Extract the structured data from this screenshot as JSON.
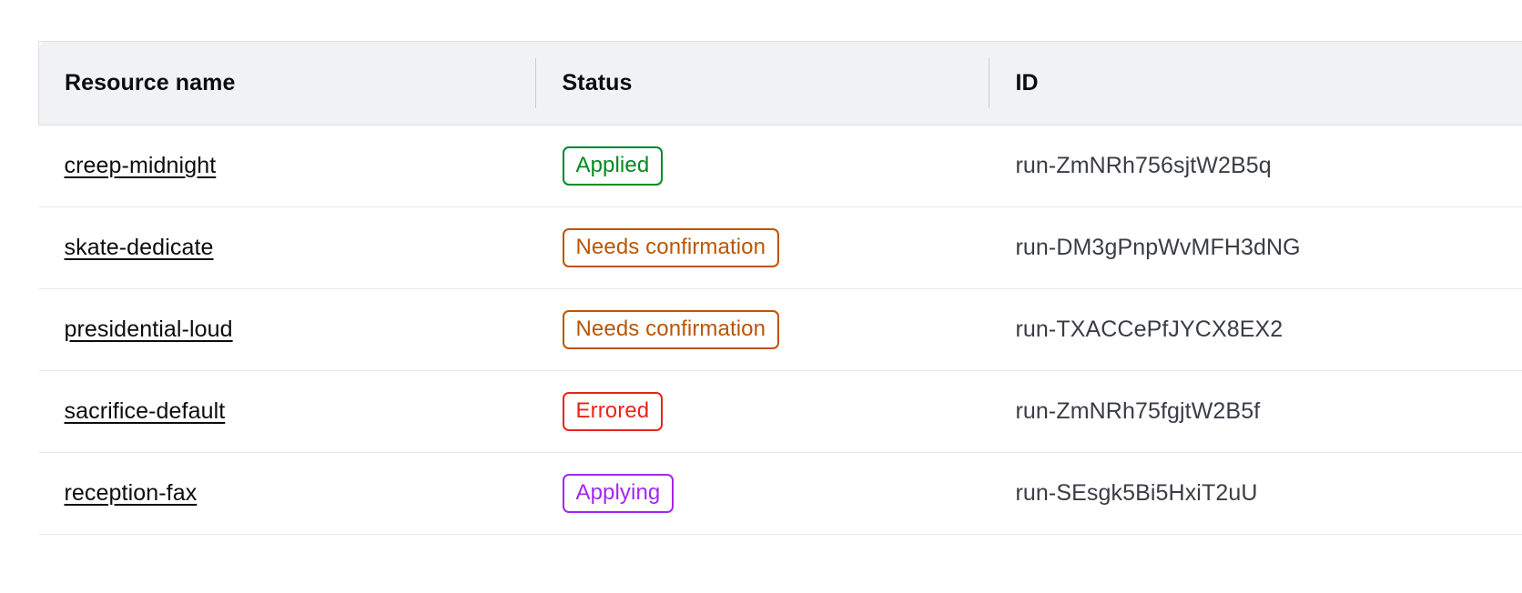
{
  "table": {
    "columns": [
      {
        "key": "name",
        "label": "Resource name"
      },
      {
        "key": "status",
        "label": "Status"
      },
      {
        "key": "id",
        "label": "ID"
      }
    ],
    "status_colors": {
      "Applied": "#008a20",
      "Needs confirmation": "#bb5504",
      "Errored": "#e8251b",
      "Applying": "#a427f0"
    },
    "rows": [
      {
        "name": "creep-midnight",
        "status": "Applied",
        "id": "run-ZmNRh756sjtW2B5q"
      },
      {
        "name": "skate-dedicate",
        "status": "Needs confirmation",
        "id": "run-DM3gPnpWvMFH3dNG"
      },
      {
        "name": "presidential-loud",
        "status": "Needs confirmation",
        "id": "run-TXACCePfJYCX8EX2"
      },
      {
        "name": "sacrifice-default",
        "status": "Errored",
        "id": "run-ZmNRh75fgjtW2B5f"
      },
      {
        "name": "reception-fax",
        "status": "Applying",
        "id": "run-SEsgk5Bi5HxiT2uU"
      }
    ]
  }
}
